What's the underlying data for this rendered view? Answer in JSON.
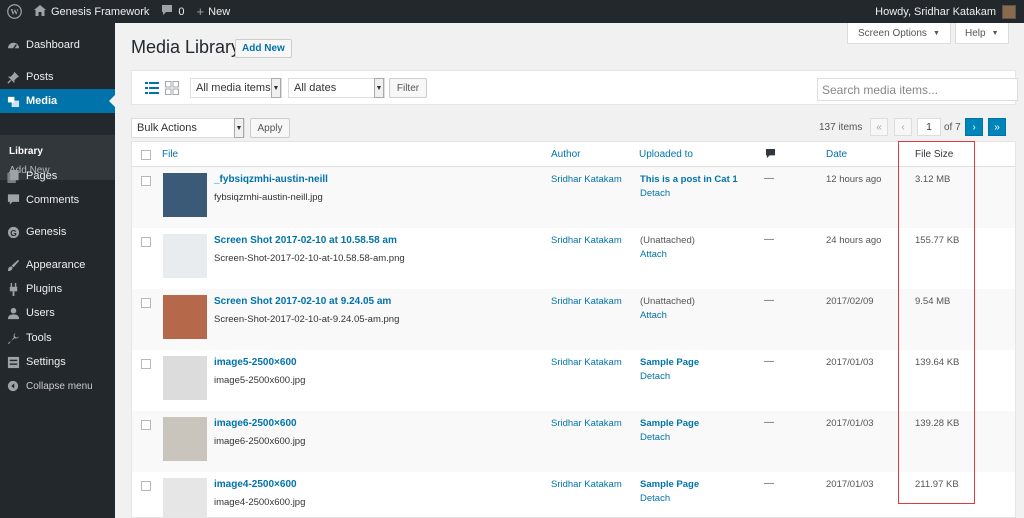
{
  "admin_bar": {
    "site_name": "Genesis Framework",
    "comments_count": "0",
    "new_label": "New",
    "greeting": "Howdy, Sridhar Katakam"
  },
  "sidebar": {
    "items": [
      {
        "label": "Dashboard",
        "icon": "dashboard-icon"
      },
      {
        "label": "Posts",
        "icon": "pin-icon"
      },
      {
        "label": "Media",
        "icon": "media-icon"
      },
      {
        "label": "Pages",
        "icon": "page-icon"
      },
      {
        "label": "Comments",
        "icon": "comment-icon"
      },
      {
        "label": "Genesis",
        "icon": "genesis-icon"
      },
      {
        "label": "Appearance",
        "icon": "brush-icon"
      },
      {
        "label": "Plugins",
        "icon": "plug-icon"
      },
      {
        "label": "Users",
        "icon": "user-icon"
      },
      {
        "label": "Tools",
        "icon": "wrench-icon"
      },
      {
        "label": "Settings",
        "icon": "settings-icon"
      },
      {
        "label": "Collapse menu",
        "icon": "collapse-icon"
      }
    ],
    "submenu": [
      "Library",
      "Add New"
    ]
  },
  "header": {
    "title": "Media Library",
    "add_new": "Add New",
    "screen_options": "Screen Options",
    "help": "Help"
  },
  "filters": {
    "media_type": "All media items",
    "dates": "All dates",
    "filter_button": "Filter",
    "search_placeholder": "Search media items..."
  },
  "bulk": {
    "action": "Bulk Actions",
    "apply": "Apply"
  },
  "pagination": {
    "count": "137 items",
    "first": "«",
    "prev": "‹",
    "current_page": "1",
    "of_pages": "of 7",
    "next": "›",
    "last": "»"
  },
  "table": {
    "columns": {
      "file": "File",
      "author": "Author",
      "uploaded_to": "Uploaded to",
      "date": "Date",
      "file_size": "File Size"
    },
    "rows": [
      {
        "title": "_fybsiqzmhi-austin-neill",
        "filename": "fybsiqzmhi-austin-neill.jpg",
        "author": "Sridhar Katakam",
        "uploaded_to": "This is a post in Cat 1",
        "uploaded_linked": true,
        "action": "Detach",
        "comments": "—",
        "date": "12 hours ago",
        "size": "3.12 MB",
        "thumb_color": "#3a5a78"
      },
      {
        "title": "Screen Shot 2017-02-10 at 10.58.58 am",
        "filename": "Screen-Shot-2017-02-10-at-10.58.58-am.png",
        "author": "Sridhar Katakam",
        "uploaded_to": "(Unattached)",
        "uploaded_linked": false,
        "action": "Attach",
        "comments": "—",
        "date": "24 hours ago",
        "size": "155.77 KB",
        "thumb_color": "#e8ecef"
      },
      {
        "title": "Screen Shot 2017-02-10 at 9.24.05 am",
        "filename": "Screen-Shot-2017-02-10-at-9.24.05-am.png",
        "author": "Sridhar Katakam",
        "uploaded_to": "(Unattached)",
        "uploaded_linked": false,
        "action": "Attach",
        "comments": "—",
        "date": "2017/02/09",
        "size": "9.54 MB",
        "thumb_color": "#b5694a"
      },
      {
        "title": "image5-2500×600",
        "filename": "image5-2500x600.jpg",
        "author": "Sridhar Katakam",
        "uploaded_to": "Sample Page",
        "uploaded_linked": true,
        "action": "Detach",
        "comments": "—",
        "date": "2017/01/03",
        "size": "139.64 KB",
        "thumb_color": "#dcdcdc"
      },
      {
        "title": "image6-2500×600",
        "filename": "image6-2500x600.jpg",
        "author": "Sridhar Katakam",
        "uploaded_to": "Sample Page",
        "uploaded_linked": true,
        "action": "Detach",
        "comments": "—",
        "date": "2017/01/03",
        "size": "139.28 KB",
        "thumb_color": "#c9c4bc"
      },
      {
        "title": "image4-2500×600",
        "filename": "image4-2500x600.jpg",
        "author": "Sridhar Katakam",
        "uploaded_to": "Sample Page",
        "uploaded_linked": true,
        "action": "Detach",
        "comments": "—",
        "date": "2017/01/03",
        "size": "211.97 KB",
        "thumb_color": "#e6e6e6"
      }
    ]
  },
  "colors": {
    "accent": "#0073aa",
    "admin_bar": "#23282d",
    "highlight": "#e03a3a"
  }
}
